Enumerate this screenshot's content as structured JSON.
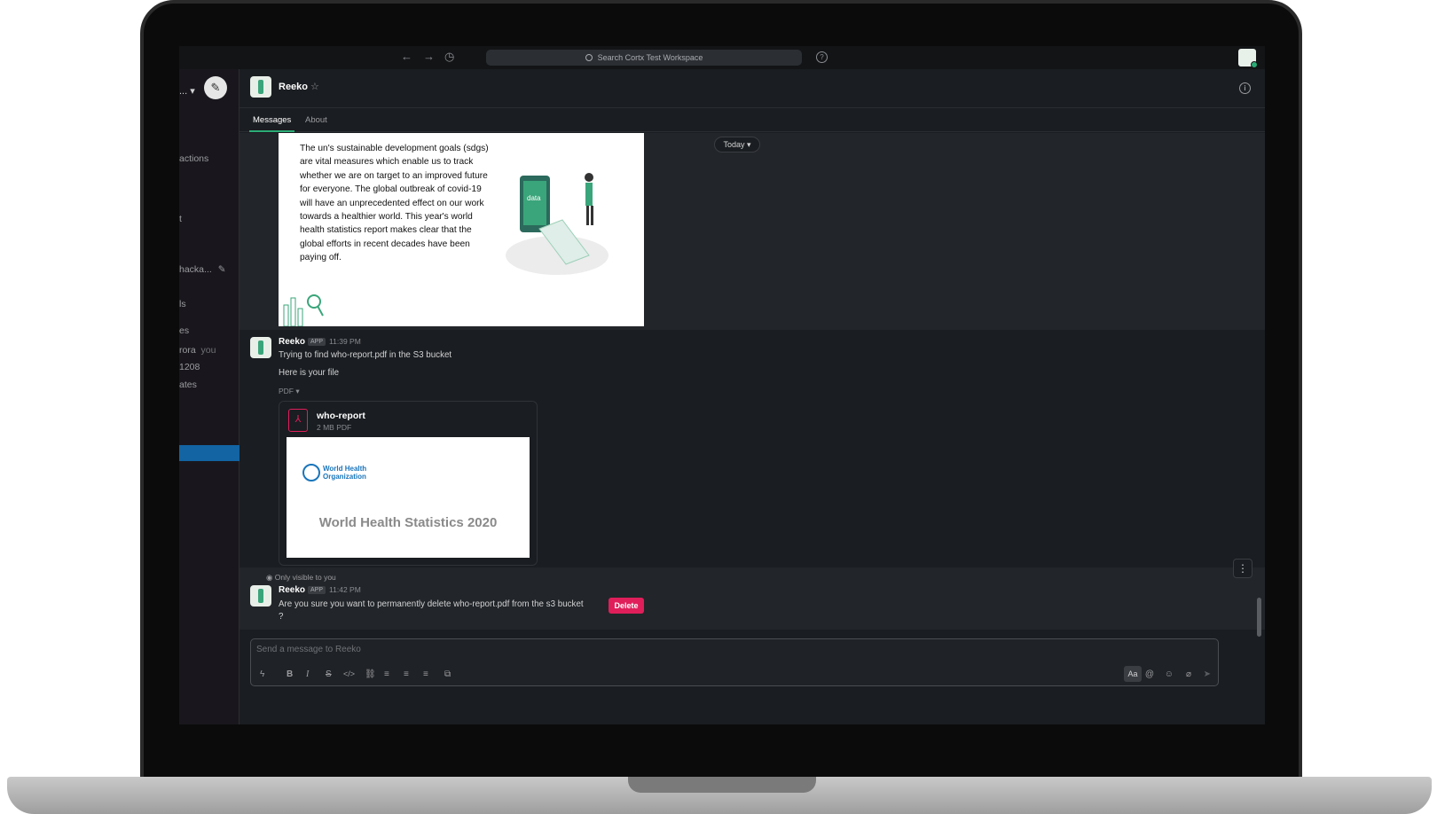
{
  "topbar": {
    "search_placeholder": "Search Cortx Test Workspace"
  },
  "sidebar": {
    "workspace": "...",
    "items": [
      "actions",
      "t",
      "hacka...",
      "ls",
      "es",
      "rora",
      "you",
      "1208",
      "ates"
    ]
  },
  "channel": {
    "name": "Reeko",
    "tabs": [
      "Messages",
      "About"
    ]
  },
  "image_card": {
    "text": "The un's sustainable development goals (sdgs) are vital measures which enable us to track whether we are on target to an improved future for everyone.  The global outbreak of covid-19 will have an unprecedented effect on our work towards a healthier world.  This year's world health statistics report makes clear that the global efforts in recent decades have been paying off.",
    "illustration_label": "data"
  },
  "date_divider": "Today",
  "message1": {
    "sender": "Reeko",
    "badge": "APP",
    "time": "11:39 PM",
    "line1": "Trying to find who-report.pdf in the S3 bucket",
    "line2": "Here is your file",
    "file_type_toggle": "PDF"
  },
  "file": {
    "name": "who-report",
    "meta": "2 MB PDF",
    "preview_org_line1": "World Health",
    "preview_org_line2": "Organization",
    "preview_title": "World Health Statistics 2020"
  },
  "message2": {
    "visibility": "Only visible to you",
    "sender": "Reeko",
    "badge": "APP",
    "time": "11:42 PM",
    "text": "Are you sure you want to permanently delete who-report.pdf from the s3 bucket",
    "text_tail": "?",
    "delete_label": "Delete"
  },
  "composer": {
    "placeholder": "Send a message to Reeko",
    "aa_label": "Aa"
  },
  "colors": {
    "accent_green": "#2bac76",
    "danger": "#e01e5a",
    "sidebar_active": "#1264a3"
  }
}
